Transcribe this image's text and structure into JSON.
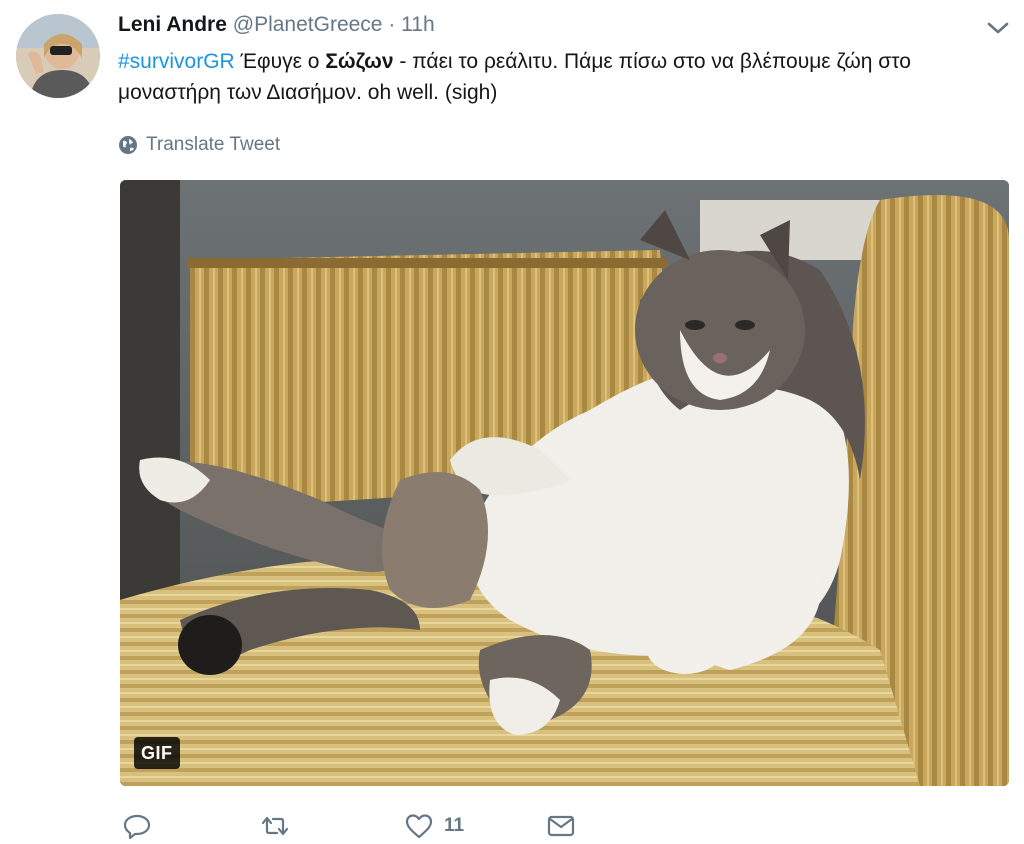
{
  "tweet": {
    "author_name": "Leni Andre",
    "handle": "@PlanetGreece",
    "separator": "·",
    "time": "11h",
    "text": {
      "hashtag": "#survivorGR",
      "part1": " Έφυγε ο ",
      "bold": "Σώζων",
      "part2": " - πάει το ρεάλιτυ. Πάμε πίσω στο να βλέπουμε ζώη στο μοναστήρη των Διασήμον.  oh well. (sigh)"
    },
    "translate_label": "Translate Tweet",
    "media": {
      "badge": "GIF",
      "icon": "cat-gif-image"
    },
    "actions": {
      "reply_icon": "reply-icon",
      "retweet_icon": "retweet-icon",
      "like_icon": "heart-icon",
      "like_count": "11",
      "dm_icon": "envelope-icon"
    }
  },
  "colors": {
    "link": "#1b95e0",
    "muted": "#657786",
    "text": "#14171a"
  }
}
